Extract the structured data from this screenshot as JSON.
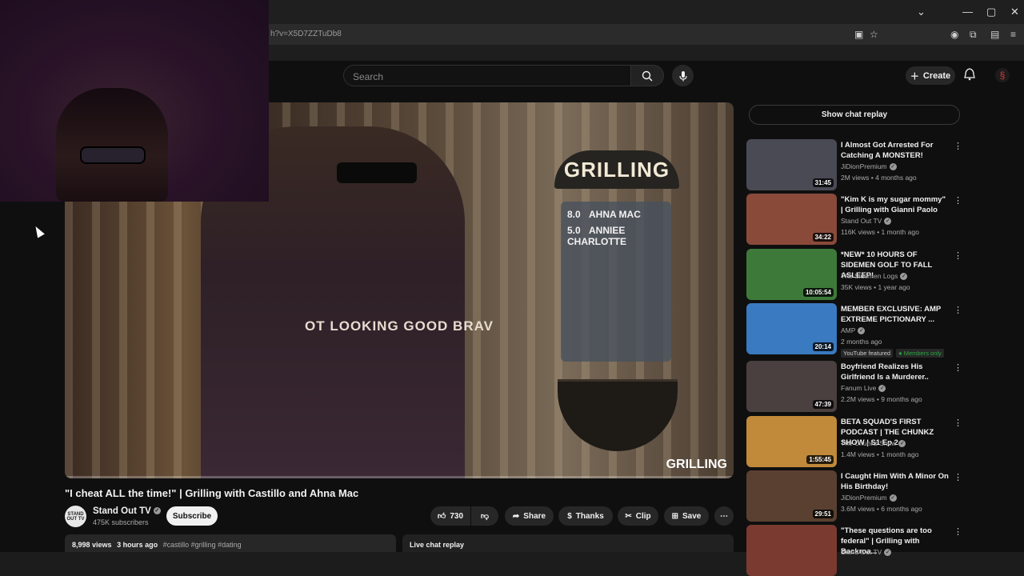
{
  "browser": {
    "url_text": "h?v=X5D7ZZTuDb8",
    "window_controls": [
      "⌄",
      "—",
      "▢",
      "✕"
    ]
  },
  "header": {
    "search_placeholder": "Search",
    "create_label": "Create"
  },
  "video": {
    "overlay_title": "GRILLING",
    "scores": [
      {
        "score": "8.0",
        "name": "AHNA MAC"
      },
      {
        "score": "5.0",
        "name": "ANNIEE CHARLOTTE"
      }
    ],
    "shirt_text": "OT LOOKING GOOD BRAV",
    "watermark": "GRILLING",
    "progress_fraction": 0.0,
    "title": "\"I cheat ALL the time!\" | Grilling with Castillo and Ahna Mac"
  },
  "channel": {
    "avatar_text": "STAND OUT TV",
    "name": "Stand Out TV",
    "subscribers": "475K subscribers",
    "subscribe_label": "Subscribe"
  },
  "actions": {
    "like_count": "730",
    "share": "Share",
    "thanks": "Thanks",
    "clip": "Clip",
    "save": "Save"
  },
  "description": {
    "views": "8,998 views",
    "age": "3 hours ago",
    "tags": "#castillo #grilling #dating"
  },
  "live_chat_label": "Live chat replay",
  "sidebar": {
    "show_chat_label": "Show chat replay",
    "recommendations": [
      {
        "title": "I Almost Got Arrested For Catching A MONSTER!",
        "channel": "JiDionPremium",
        "meta": "2M views • 4 months ago",
        "duration": "31:45",
        "thumb_color": "#4a4a55"
      },
      {
        "title": "\"Kim K is my sugar mommy\" | Grilling with Gianni Paolo",
        "channel": "Stand Out TV",
        "meta": "116K views • 1 month ago",
        "duration": "34:22",
        "thumb_color": "#8a4a3a"
      },
      {
        "title": "*NEW* 10 HOURS OF SIDEMEN GOLF TO FALL ASLEEP!",
        "channel": "The Sidemen Logs",
        "meta": "35K views • 1 year ago",
        "duration": "10:05:54",
        "thumb_color": "#3d7a3a"
      },
      {
        "title": "MEMBER EXCLUSIVE: AMP EXTREME PICTIONARY ...",
        "channel": "AMP",
        "meta": "2 months ago",
        "duration": "20:14",
        "thumb_color": "#3a7ac0",
        "badges": [
          "YouTube featured",
          "Members only"
        ]
      },
      {
        "title": "Boyfriend Realizes His Girlfriend Is a Murderer..",
        "channel": "Fanum Live",
        "meta": "2.2M views • 9 months ago",
        "duration": "47:39",
        "thumb_color": "#4a4040"
      },
      {
        "title": "BETA SQUAD'S FIRST PODCAST | THE CHUNKZ SHOW | S1 Ep 2",
        "channel": "The Chunkz Show",
        "meta": "1.4M views • 1 month ago",
        "duration": "1:55:45",
        "thumb_color": "#c08a3a"
      },
      {
        "title": "I Caught Him With A Minor On His Birthday!",
        "channel": "JiDionPremium",
        "meta": "3.6M views • 6 months ago",
        "duration": "29:51",
        "thumb_color": "#5a4030"
      },
      {
        "title": "\"These questions are too federal\" | Grilling with Backroa...",
        "channel": "Stand Out TV",
        "meta": "",
        "duration": "",
        "thumb_color": "#7a3a30"
      }
    ]
  }
}
